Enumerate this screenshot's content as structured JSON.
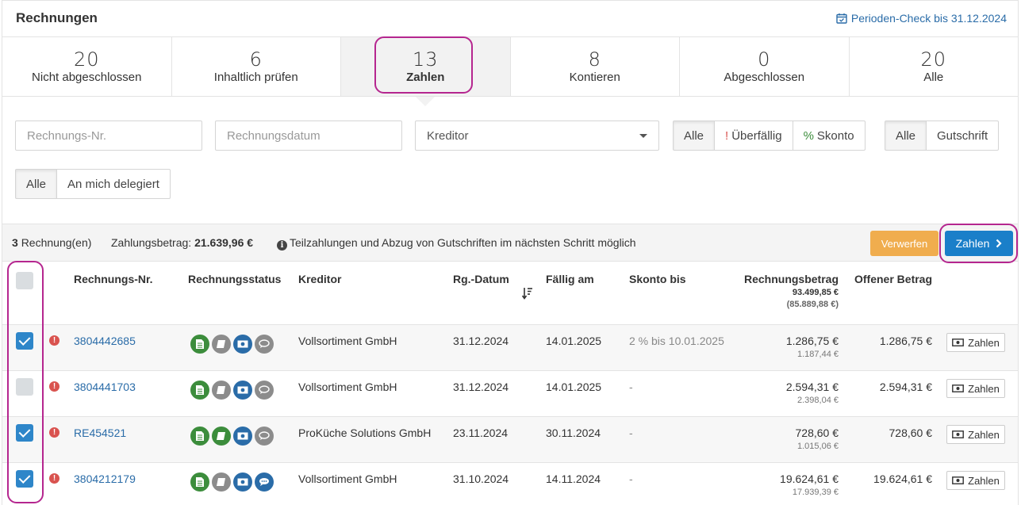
{
  "header": {
    "title": "Rechnungen",
    "period_check": "Perioden-Check bis 31.12.2024"
  },
  "stats": [
    {
      "count": "20",
      "label": "Nicht abgeschlossen"
    },
    {
      "count": "6",
      "label": "Inhaltlich prüfen"
    },
    {
      "count": "13",
      "label": "Zahlen"
    },
    {
      "count": "8",
      "label": "Kontieren"
    },
    {
      "count": "0",
      "label": "Abgeschlossen"
    },
    {
      "count": "20",
      "label": "Alle"
    }
  ],
  "filters": {
    "invoice_no_placeholder": "Rechnungs-Nr.",
    "invoice_date_placeholder": "Rechnungsdatum",
    "creditor_value": "Kreditor",
    "status_group": {
      "all": "Alle",
      "overdue_mark": "!",
      "overdue": "Überfällig",
      "discount_mark": "%",
      "discount": "Skonto"
    },
    "type_group": {
      "all": "Alle",
      "credit": "Gutschrift"
    },
    "delegate_group": {
      "all": "Alle",
      "delegated": "An mich delegiert"
    }
  },
  "summary": {
    "count": "3",
    "count_suffix": "Rechnung(en)",
    "payment_label": "Zahlungsbetrag:",
    "payment_amount": "21.639,96 €",
    "info_text": "Teilzahlungen und Abzug von Gutschriften im nächsten Schritt möglich",
    "discard_label": "Verwerfen",
    "pay_label": "Zahlen"
  },
  "table": {
    "columns": {
      "invoice_no": "Rechnungs-Nr.",
      "status": "Rechnungsstatus",
      "creditor": "Kreditor",
      "invoice_date": "Rg.-Datum",
      "due": "Fällig am",
      "discount": "Skonto bis",
      "amount": "Rechnungsbetrag",
      "amount_total": "93.499,85 €",
      "amount_total_sub": "(85.889,88 €)",
      "open": "Offener Betrag"
    },
    "rows": [
      {
        "checked": true,
        "invoice_no": "3804442685",
        "creditor": "Vollsortiment GmbH",
        "date": "31.12.2024",
        "due": "14.01.2025",
        "discount": "2 % bis 10.01.2025",
        "amount": "1.286,75 €",
        "amount_sub": "1.187,44 €",
        "open": "1.286,75 €",
        "action": "Zahlen"
      },
      {
        "checked": false,
        "invoice_no": "3804441703",
        "creditor": "Vollsortiment GmbH",
        "date": "31.12.2024",
        "due": "14.01.2025",
        "discount": "-",
        "amount": "2.594,31 €",
        "amount_sub": "2.398,04 €",
        "open": "2.594,31 €",
        "action": "Zahlen"
      },
      {
        "checked": true,
        "invoice_no": "RE454521",
        "creditor": "ProKüche Solutions GmbH",
        "date": "23.11.2024",
        "due": "30.11.2024",
        "discount": "-",
        "amount": "728,60 €",
        "amount_sub": "1.015,06 €",
        "open": "728,60 €",
        "action": "Zahlen"
      },
      {
        "checked": true,
        "invoice_no": "3804212179",
        "creditor": "Vollsortiment GmbH",
        "date": "31.10.2024",
        "due": "14.11.2024",
        "discount": "-",
        "amount": "19.624,61 €",
        "amount_sub": "17.939,39 €",
        "open": "19.624,61 €",
        "action": "Zahlen"
      }
    ]
  },
  "colors": {
    "accent": "#1a7fc9",
    "warning": "#f0ad4e",
    "danger": "#d9534f",
    "highlight": "#b5268f"
  }
}
